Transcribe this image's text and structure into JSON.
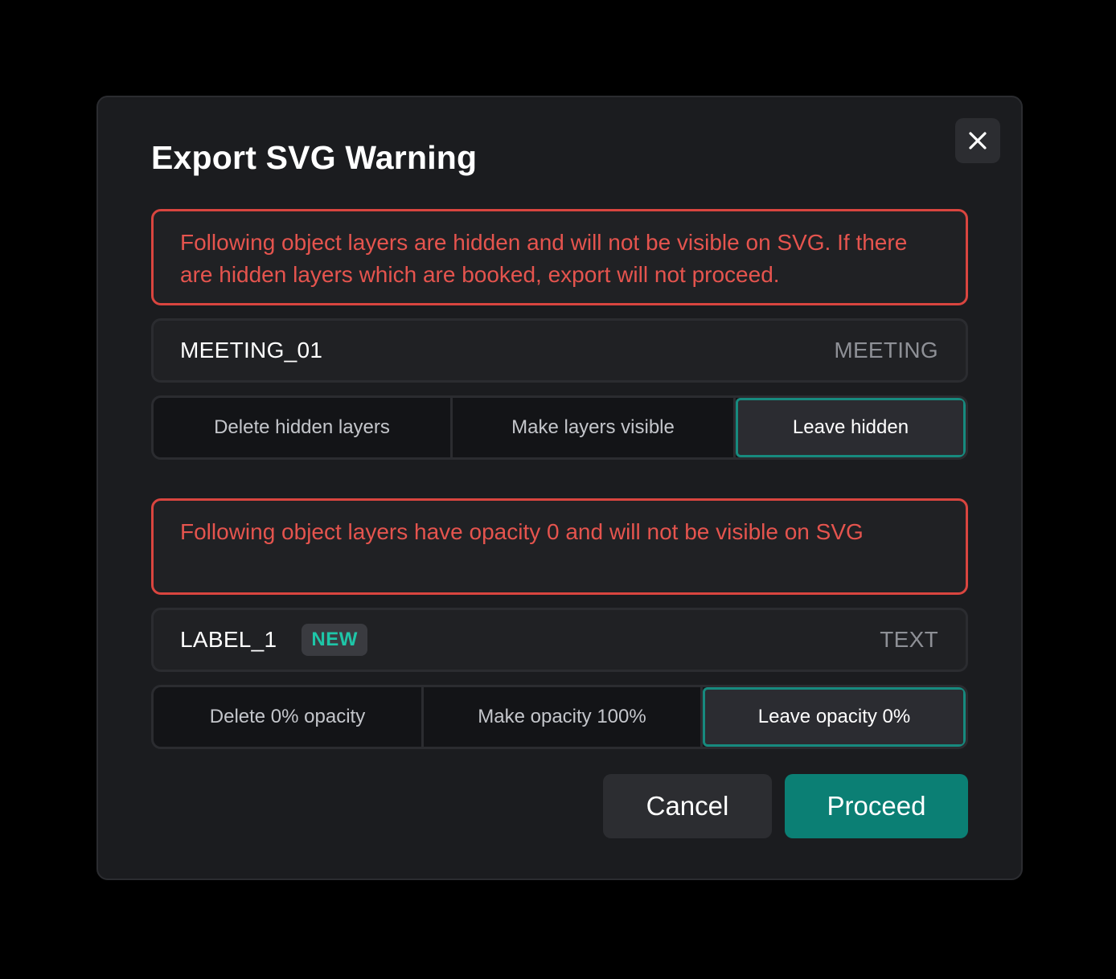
{
  "dialog": {
    "title": "Export SVG Warning",
    "close_icon": "close-icon"
  },
  "hidden_section": {
    "warning": "Following object layers are hidden and will not be visible on SVG. If there are hidden layers which are booked, export will not proceed.",
    "layer": {
      "name": "MEETING_01",
      "type": "MEETING"
    },
    "options": [
      "Delete hidden layers",
      "Make layers visible",
      "Leave hidden"
    ],
    "selected_option": "Leave hidden"
  },
  "opacity_section": {
    "warning": "Following object layers have opacity 0 and will not be visible on SVG",
    "layer": {
      "name": "LABEL_1",
      "badge": "NEW",
      "type": "TEXT"
    },
    "options": [
      "Delete 0% opacity",
      "Make opacity 100%",
      "Leave opacity 0%"
    ],
    "selected_option": "Leave opacity 0%"
  },
  "actions": {
    "cancel_label": "Cancel",
    "proceed_label": "Proceed"
  },
  "colors": {
    "background": "#000000",
    "dialog": "#1b1c1f",
    "warning": "#e5544e",
    "accent": "#0b7f74",
    "badge_text": "#1ec6a8"
  }
}
